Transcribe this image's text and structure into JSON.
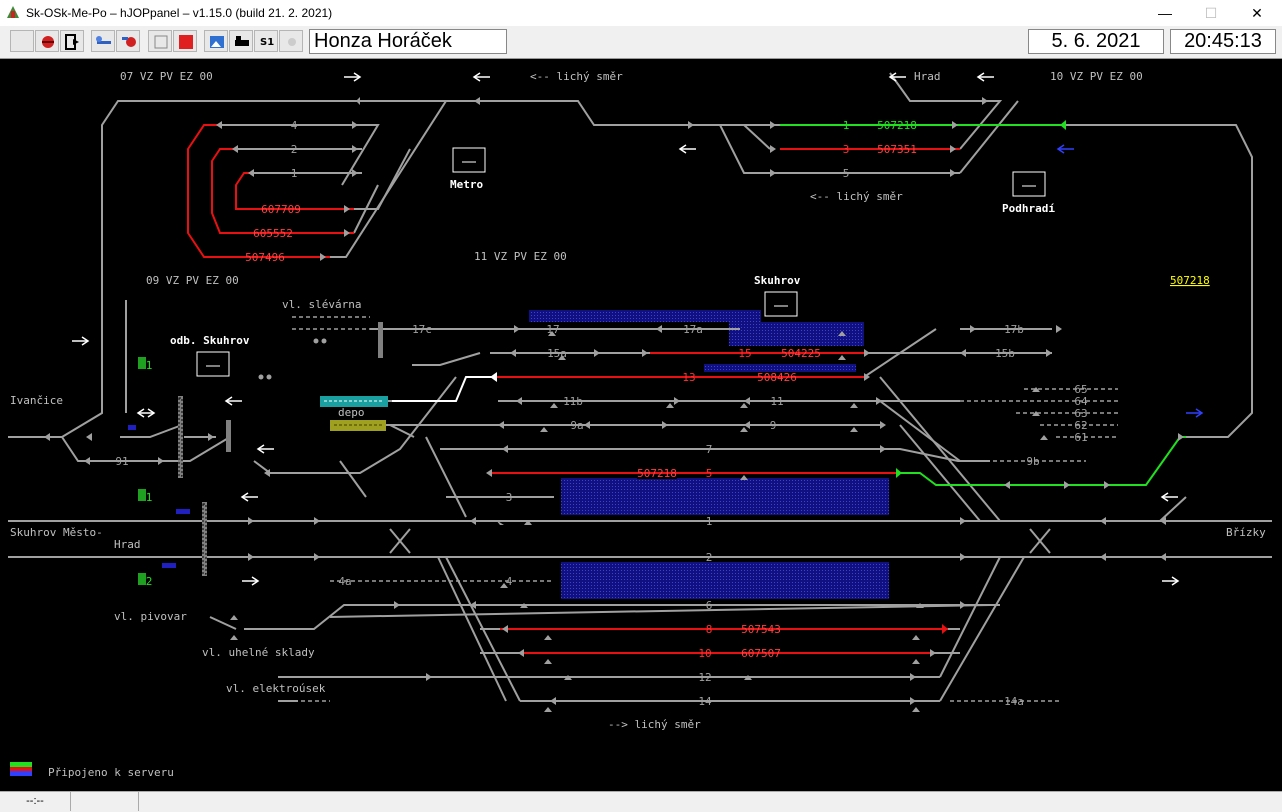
{
  "window": {
    "title": "Sk-OSk-Me-Po – hJOPpanel – v1.15.0 (build 21. 2. 2021)"
  },
  "toolbar": {
    "user": "Honza Horáček",
    "date": "5. 6. 2021",
    "time": "20:45:13"
  },
  "panel": {
    "ctrl_07": "07 VZ PV EZ 00",
    "ctrl_09": "09 VZ PV EZ 00",
    "ctrl_10": "10 VZ PV EZ 00",
    "ctrl_11": "11 VZ PV EZ 00",
    "dir_odd_top": "<-- lichý směr",
    "dir_odd_mid": "<-- lichý směr",
    "dir_odd_bottom": "--> lichý směr",
    "hrad": "Hrad",
    "metro": "Metro",
    "podhradi": "Podhradí",
    "skuhrov": "Skuhrov",
    "odb_skuhrov": "odb. Skuhrov",
    "ivancice": "Ivančice",
    "skuhrov_mesto_1": "Skuhrov Město-",
    "skuhrov_mesto_2": "Hrad",
    "brizky": "Břízky",
    "vl_slevarna": "vl. slévárna",
    "vl_pivovar": "vl. pivovar",
    "vl_uhelne": "vl. uhelné sklady",
    "vl_elektro": "vl. elektroúsek",
    "depo": "depo",
    "loose_train": "507218",
    "status_connected": "Připojeno k serveru",
    "status_cell": "--:--",
    "tracks": {
      "t1": "1",
      "t2": "2",
      "t3": "3",
      "t4": "4",
      "t5": "5",
      "t6": "6",
      "t7": "7",
      "t8": "8",
      "t9": "9",
      "t9a": "9a",
      "t9b": "9b",
      "t10": "10",
      "t11": "11",
      "t11b": "11b",
      "t12": "12",
      "t13": "13",
      "t14": "14",
      "t14a": "14a",
      "t15": "15",
      "t15a": "15a",
      "t15b": "15b",
      "t17": "17",
      "t17a": "17a",
      "t17b": "17b",
      "t17c": "17c",
      "t4a": "4a",
      "t91": "91",
      "t61": "61",
      "t62": "62",
      "t63": "63",
      "t64": "64",
      "t65": "65",
      "k4": "4",
      "k2": "2",
      "k1": "1",
      "h1": "1",
      "h3": "3",
      "h5": "5",
      "s1a": "1",
      "s1b": "1",
      "s2": "2"
    },
    "trains": {
      "tr_607709": "607709",
      "tr_605552": "605552",
      "tr_507496": "507496",
      "tr_507218_top": "507218",
      "tr_507351": "507351",
      "tr_504225": "504225",
      "tr_508426": "508426",
      "tr_507218_5": "507218",
      "tr_507543": "507543",
      "tr_607507": "607507"
    }
  },
  "colors": {
    "track_free": "#a0a0a0",
    "track_occupied": "#ff0000",
    "track_route": "#00ff00",
    "blue_block": "#1a1aa0",
    "train_label": "#ff4040",
    "yellow": "#ffff00"
  }
}
